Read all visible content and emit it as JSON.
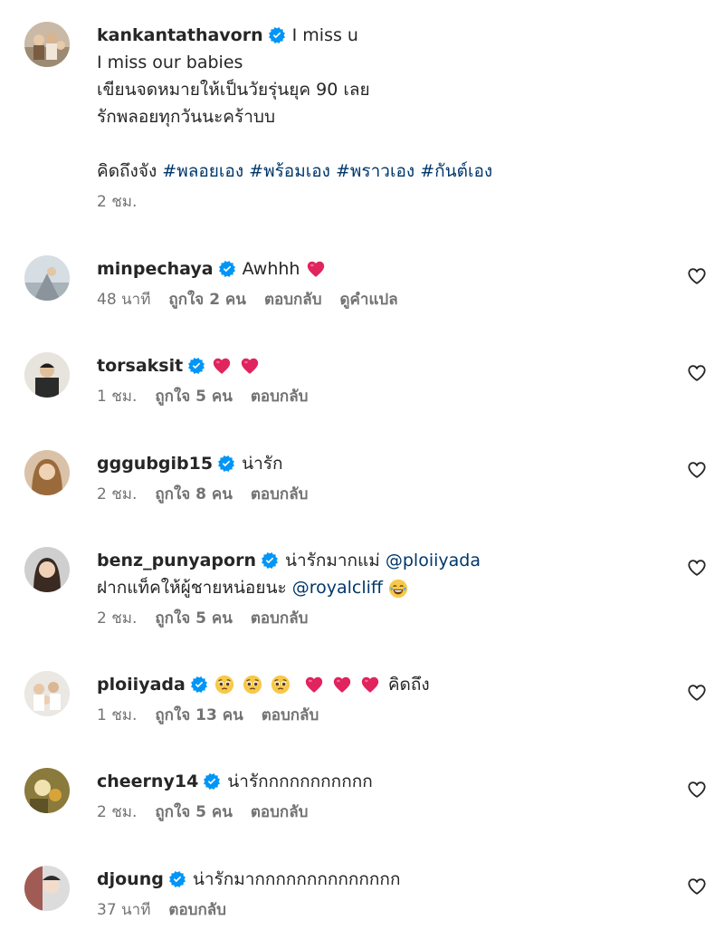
{
  "post": {
    "username": "kankantathavorn",
    "lines": [
      "I miss u",
      "I miss our babies",
      "เขียนจดหมายให้เป็นวัยรุ่นยุค 90 เลย",
      "รักพลอยทุกวันนะคร้าบบ"
    ],
    "last_line_prefix": "คิดถึงจัง ",
    "hashtags": [
      "#พลอยเอง",
      "#พร้อมเอง",
      "#พราวเอง",
      "#กันต์เอง"
    ],
    "time": "2 ชม."
  },
  "comments": [
    {
      "username": "minpechaya",
      "text": "Awhhh ",
      "emojis": [
        "heart"
      ],
      "time": "48 นาที",
      "likes": "ถูกใจ 2 คน",
      "reply": "ตอบกลับ",
      "translate": "ดูคำแปล"
    },
    {
      "username": "torsaksit",
      "text": "",
      "emojis": [
        "heart",
        "heart"
      ],
      "time": "1 ชม.",
      "likes": "ถูกใจ 5 คน",
      "reply": "ตอบกลับ"
    },
    {
      "username": "gggubgib15",
      "text": "น่ารัก",
      "emojis": [],
      "time": "2 ชม.",
      "likes": "ถูกใจ 8 คน",
      "reply": "ตอบกลับ"
    },
    {
      "username": "benz_punyaporn",
      "text": "น่ารักมากแม่ ",
      "mention1": "@ploiiyada",
      "line2_text": "ฝากแท็คให้ผู้ชายหน่อยนะ ",
      "mention2": "@royalcliff",
      "emojis_line2": [
        "laugh"
      ],
      "time": "2 ชม.",
      "likes": "ถูกใจ 5 คน",
      "reply": "ตอบกลับ"
    },
    {
      "username": "ploiiyada",
      "text": "คิดถึง",
      "emojis": [
        "pleading",
        "pleading",
        "pleading",
        "heart",
        "heart",
        "heart"
      ],
      "time": "1 ชม.",
      "likes": "ถูกใจ 13 คน",
      "reply": "ตอบกลับ"
    },
    {
      "username": "cheerny14",
      "text": "น่ารักกกกกกกกกกก",
      "emojis": [],
      "time": "2 ชม.",
      "likes": "ถูกใจ 5 คน",
      "reply": "ตอบกลับ"
    },
    {
      "username": "djoung",
      "text": "น่ารักมากกกกกกกกกกกกกก",
      "emojis": [],
      "time": "37 นาที",
      "reply": "ตอบกลับ"
    }
  ],
  "colors": {
    "text": "#262626",
    "secondary": "#737373",
    "link": "#00376b",
    "verified": "#0095f6",
    "heart_emoji": "#e0245e"
  },
  "icons": {
    "verified": "verified-badge-icon",
    "like": "heart-outline-icon"
  }
}
